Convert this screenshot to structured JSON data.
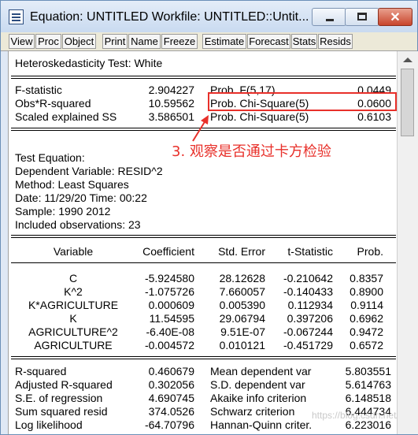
{
  "window": {
    "title": "Equation: UNTITLED   Workfile: UNTITLED::Untit...",
    "controls": {
      "minimize_icon": "minimize-icon",
      "maximize_icon": "maximize-icon",
      "close_icon": "close-icon",
      "close_glyph": "✕"
    }
  },
  "toolbar": [
    {
      "label": "View"
    },
    {
      "label": "Proc"
    },
    {
      "label": "Object"
    },
    {
      "label": "Print"
    },
    {
      "label": "Name"
    },
    {
      "label": "Freeze"
    },
    {
      "label": "Estimate"
    },
    {
      "label": "Forecast"
    },
    {
      "label": "Stats"
    },
    {
      "label": "Resids"
    }
  ],
  "output": {
    "heading": "Heteroskedasticity Test: White",
    "tests": [
      {
        "label": "F-statistic",
        "value": "2.904227",
        "prob_label": "Prob. F(5,17)",
        "prob": "0.0449"
      },
      {
        "label": "Obs*R-squared",
        "value": "10.59562",
        "prob_label": "Prob. Chi-Square(5)",
        "prob": "0.0600"
      },
      {
        "label": "Scaled explained SS",
        "value": "3.586501",
        "prob_label": "Prob. Chi-Square(5)",
        "prob": "0.6103"
      }
    ],
    "test_equation": [
      "Test Equation:",
      "Dependent Variable: RESID^2",
      "Method: Least Squares",
      "Date: 11/29/20   Time: 00:22",
      "Sample: 1990 2012",
      "Included observations: 23"
    ],
    "coef_headers": [
      "Variable",
      "Coefficient",
      "Std. Error",
      "t-Statistic",
      "Prob."
    ],
    "coef_rows": [
      [
        "C",
        "-5.924580",
        "28.12628",
        "-0.210642",
        "0.8357"
      ],
      [
        "K^2",
        "-1.075726",
        "7.660057",
        "-0.140433",
        "0.8900"
      ],
      [
        "K*AGRICULTURE",
        "0.000609",
        "0.005390",
        "0.112934",
        "0.9114"
      ],
      [
        "K",
        "11.54595",
        "29.06794",
        "0.397206",
        "0.6962"
      ],
      [
        "AGRICULTURE^2",
        "-6.40E-08",
        "9.51E-07",
        "-0.067244",
        "0.9472"
      ],
      [
        "AGRICULTURE",
        "-0.004572",
        "0.010121",
        "-0.451729",
        "0.6572"
      ]
    ],
    "stats": [
      [
        "R-squared",
        "0.460679",
        "Mean dependent var",
        "5.803551"
      ],
      [
        "Adjusted R-squared",
        "0.302056",
        "S.D. dependent var",
        "5.614763"
      ],
      [
        "S.E. of regression",
        "4.690745",
        "Akaike info criterion",
        "6.148518"
      ],
      [
        "Sum squared resid",
        "374.0526",
        "Schwarz criterion",
        "6.444734"
      ],
      [
        "Log likelihood",
        "-64.70796",
        "Hannan-Quinn criter.",
        "6.223016"
      ]
    ]
  },
  "annotation": {
    "text": "3. 观察是否通过卡方检验",
    "color": "#e8302a",
    "arrow_icon": "arrow-icon"
  },
  "watermark": "https://blog.csdn.net/qq_..."
}
